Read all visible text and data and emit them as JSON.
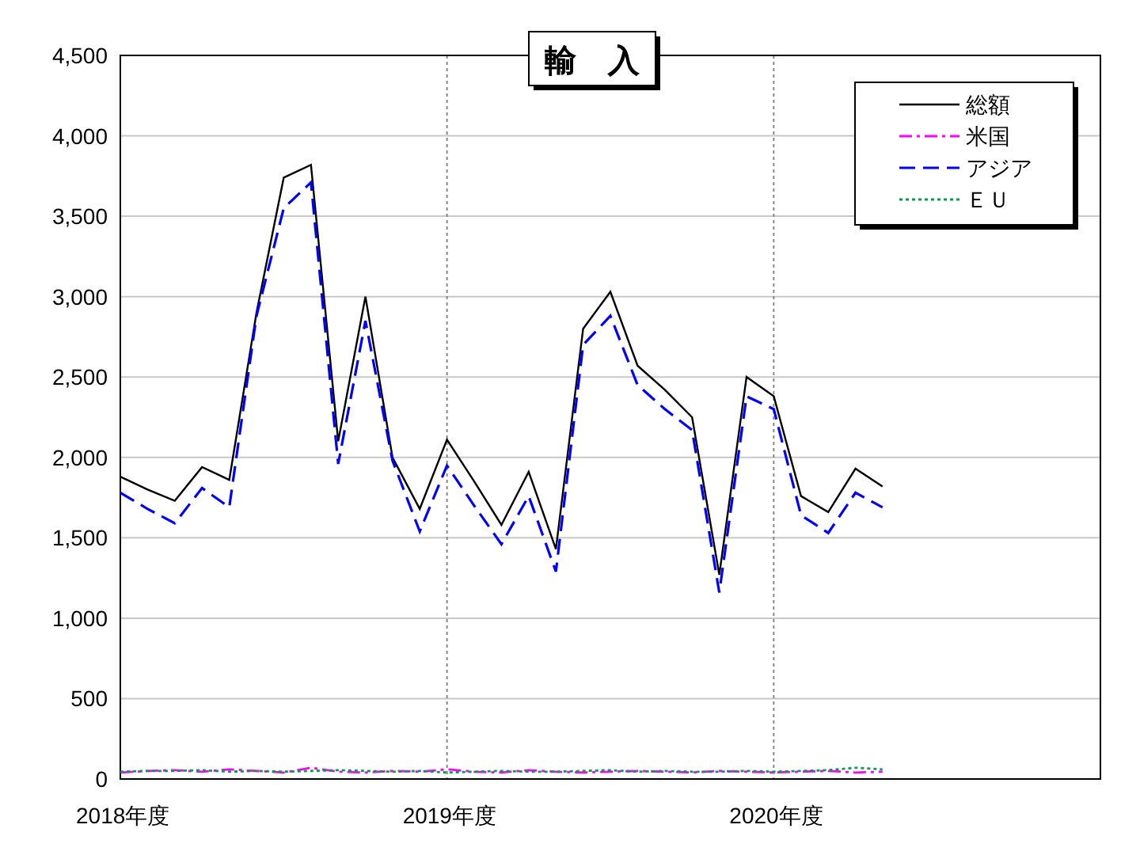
{
  "chart_data": {
    "type": "line",
    "title": "輸　入",
    "categories": [
      "2018年度",
      null,
      null,
      null,
      null,
      null,
      null,
      null,
      null,
      null,
      null,
      null,
      "2019年度",
      null,
      null,
      null,
      null,
      null,
      null,
      null,
      null,
      null,
      null,
      null,
      "2020年度",
      null,
      null,
      null,
      null,
      null,
      null,
      null,
      null,
      null,
      null,
      null
    ],
    "ylim": [
      0,
      4500
    ],
    "yticks": [
      {
        "value": 0,
        "label": "0"
      },
      {
        "value": 500,
        "label": "500"
      },
      {
        "value": 1000,
        "label": "1,000"
      },
      {
        "value": 1500,
        "label": "1,500"
      },
      {
        "value": 2000,
        "label": "2,000"
      },
      {
        "value": 2500,
        "label": "2,500"
      },
      {
        "value": 3000,
        "label": "3,000"
      },
      {
        "value": 3500,
        "label": "3,500"
      },
      {
        "value": 4000,
        "label": "4,000"
      },
      {
        "value": 4500,
        "label": "4,500"
      }
    ],
    "grid": true,
    "legend": true,
    "series": [
      {
        "name": "総額",
        "color": "#000000",
        "line_style": "solid",
        "values": [
          1880,
          1800,
          1730,
          1940,
          1860,
          2900,
          3740,
          3820,
          2100,
          3000,
          2000,
          1680,
          2110,
          1850,
          1580,
          1910,
          1430,
          2800,
          3030,
          2570,
          2420,
          2250,
          1270,
          2500,
          2380,
          1760,
          1660,
          1930,
          1820,
          null,
          null,
          null,
          null,
          null,
          null,
          null
        ]
      },
      {
        "name": "米国",
        "color": "#ff00ff",
        "line_style": "dashdot",
        "values": [
          40,
          50,
          55,
          45,
          60,
          50,
          40,
          70,
          45,
          40,
          50,
          45,
          60,
          45,
          40,
          55,
          45,
          40,
          45,
          50,
          45,
          40,
          50,
          45,
          40,
          45,
          50,
          40,
          45,
          null,
          null,
          null,
          null,
          null,
          null,
          null
        ]
      },
      {
        "name": "アジア",
        "color": "#0000ff",
        "line_style": "dashed",
        "values": [
          1780,
          1680,
          1590,
          1810,
          1690,
          2880,
          3550,
          3710,
          1960,
          2850,
          1980,
          1540,
          1950,
          1700,
          1460,
          1760,
          1290,
          2700,
          2880,
          2450,
          2300,
          2170,
          1160,
          2380,
          2300,
          1640,
          1530,
          1780,
          1690,
          null,
          null,
          null,
          null,
          null,
          null,
          null
        ]
      },
      {
        "name": "ＥＵ",
        "color": "#00a050",
        "line_style": "dotted",
        "values": [
          45,
          50,
          50,
          55,
          45,
          50,
          45,
          50,
          55,
          50,
          45,
          50,
          40,
          45,
          50,
          45,
          45,
          50,
          55,
          45,
          50,
          45,
          45,
          50,
          45,
          50,
          55,
          70,
          60,
          null,
          null,
          null,
          null,
          null,
          null,
          null
        ]
      }
    ]
  }
}
